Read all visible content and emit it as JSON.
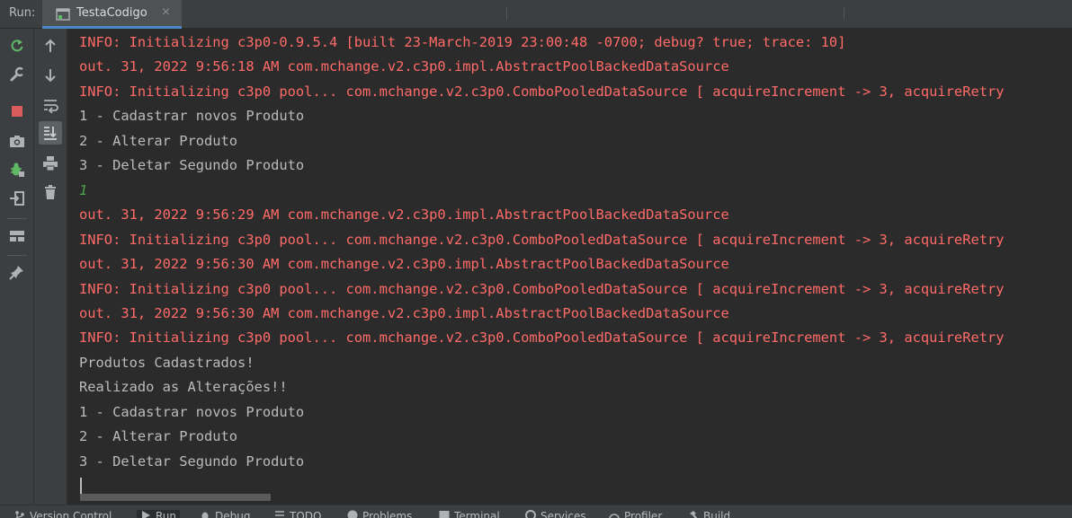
{
  "run_panel": {
    "label": "Run:",
    "tab_title": "TestaCodigo",
    "close_glyph": "×"
  },
  "left_toolbar": [
    {
      "name": "rerun-icon",
      "color": "#5fb865"
    },
    {
      "name": "wrench-icon",
      "color": "#afb1b3"
    },
    {
      "name": "stop-icon",
      "color": "#db5c5c"
    },
    {
      "name": "camera-icon",
      "color": "#afb1b3"
    },
    {
      "name": "debug-bug-icon",
      "color": "#5fb865"
    },
    {
      "name": "exit-icon",
      "color": "#afb1b3"
    },
    {
      "name": "layout-icon",
      "color": "#afb1b3"
    },
    {
      "name": "pin-icon",
      "color": "#afb1b3"
    }
  ],
  "inner_toolbar": [
    {
      "name": "up-arrow-icon"
    },
    {
      "name": "down-arrow-icon"
    },
    {
      "name": "soft-wrap-icon"
    },
    {
      "name": "scroll-to-end-icon",
      "active": true
    },
    {
      "name": "print-icon"
    },
    {
      "name": "trash-icon"
    }
  ],
  "console": {
    "lines": [
      {
        "text": "INFO: Initializing c3p0-0.9.5.4 [built 23-March-2019 23:00:48 -0700; debug? true; trace: 10]",
        "kind": "err"
      },
      {
        "text": "out. 31, 2022 9:56:18 AM com.mchange.v2.c3p0.impl.AbstractPoolBackedDataSource",
        "kind": "err"
      },
      {
        "text": "INFO: Initializing c3p0 pool... com.mchange.v2.c3p0.ComboPooledDataSource [ acquireIncrement -> 3, acquireRetry",
        "kind": "err"
      },
      {
        "text": "1 - Cadastrar novos Produto",
        "kind": "out"
      },
      {
        "text": "2 - Alterar Produto",
        "kind": "out"
      },
      {
        "text": "3 - Deletar Segundo Produto",
        "kind": "out"
      },
      {
        "text": "1",
        "kind": "in"
      },
      {
        "text": "out. 31, 2022 9:56:29 AM com.mchange.v2.c3p0.impl.AbstractPoolBackedDataSource",
        "kind": "err"
      },
      {
        "text": "INFO: Initializing c3p0 pool... com.mchange.v2.c3p0.ComboPooledDataSource [ acquireIncrement -> 3, acquireRetry",
        "kind": "err"
      },
      {
        "text": "out. 31, 2022 9:56:30 AM com.mchange.v2.c3p0.impl.AbstractPoolBackedDataSource",
        "kind": "err"
      },
      {
        "text": "INFO: Initializing c3p0 pool... com.mchange.v2.c3p0.ComboPooledDataSource [ acquireIncrement -> 3, acquireRetry",
        "kind": "err"
      },
      {
        "text": "out. 31, 2022 9:56:30 AM com.mchange.v2.c3p0.impl.AbstractPoolBackedDataSource",
        "kind": "err"
      },
      {
        "text": "INFO: Initializing c3p0 pool... com.mchange.v2.c3p0.ComboPooledDataSource [ acquireIncrement -> 3, acquireRetry",
        "kind": "err"
      },
      {
        "text": "Produtos Cadastrados!",
        "kind": "out"
      },
      {
        "text": "Realizado as Alterações!!",
        "kind": "out"
      },
      {
        "text": "1 - Cadastrar novos Produto",
        "kind": "out"
      },
      {
        "text": "2 - Alterar Produto",
        "kind": "out"
      },
      {
        "text": "3 - Deletar Segundo Produto",
        "kind": "out"
      }
    ]
  },
  "bottom_bar": {
    "items": [
      {
        "label": "Version Control",
        "icon": "branch-icon"
      },
      {
        "label": "Run",
        "icon": "play-icon",
        "active": true
      },
      {
        "label": "Debug",
        "icon": "bug-icon"
      },
      {
        "label": "TODO",
        "icon": "list-icon"
      },
      {
        "label": "Problems",
        "icon": "warning-icon"
      },
      {
        "label": "Terminal",
        "icon": "terminal-icon"
      },
      {
        "label": "Services",
        "icon": "services-icon"
      },
      {
        "label": "Profiler",
        "icon": "gauge-icon"
      },
      {
        "label": "Build",
        "icon": "hammer-icon"
      }
    ]
  },
  "colors": {
    "stderr": "#ff6b68",
    "stdout": "#bbbbbb",
    "stdin": "#4fa34f",
    "accent": "#4a88c7"
  }
}
